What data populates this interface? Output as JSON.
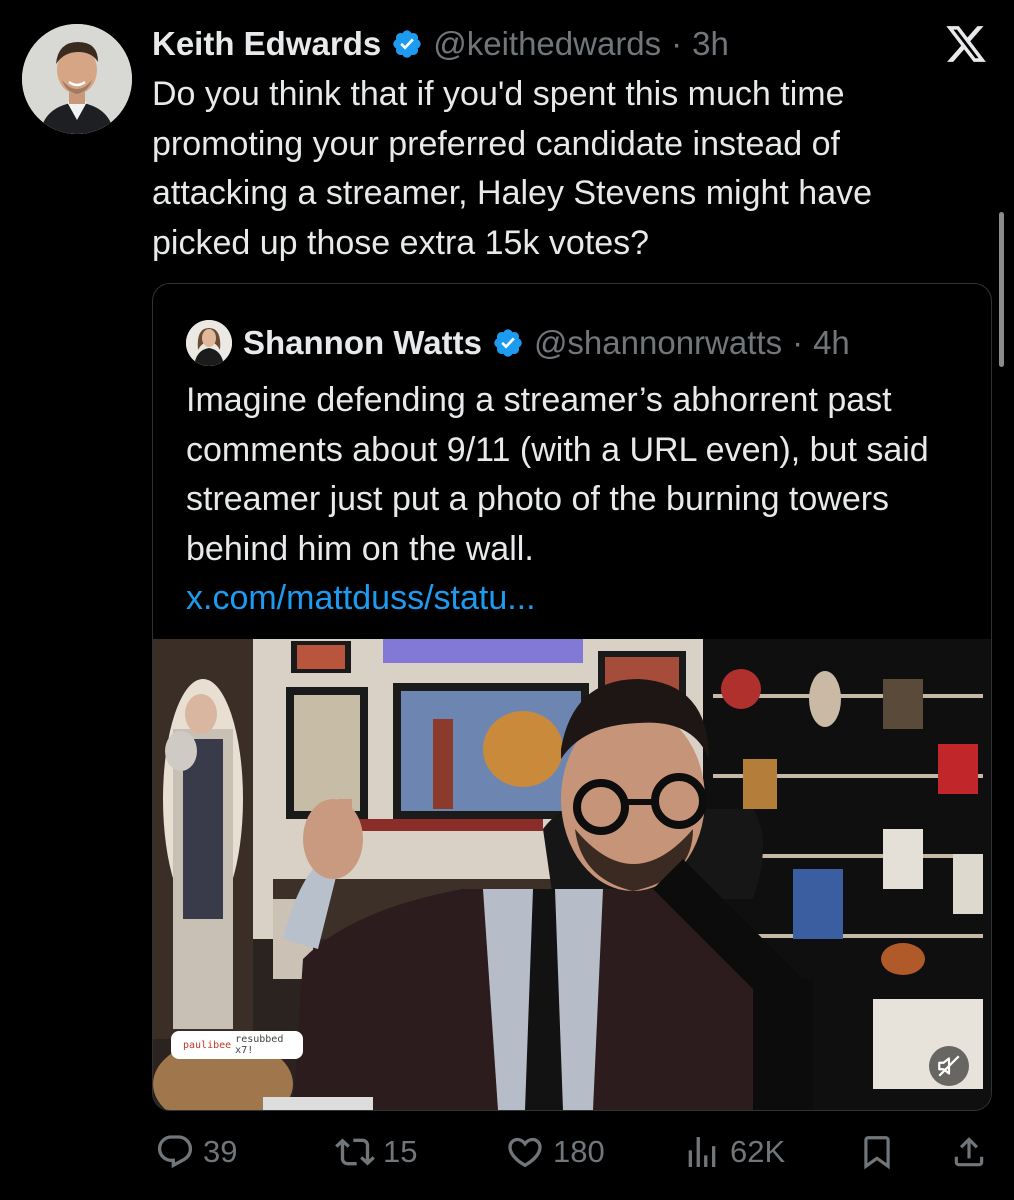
{
  "tweet": {
    "author": {
      "name": "Keith Edwards",
      "handle": "@keithedwards",
      "separator": "·",
      "time": "3h",
      "verified": true
    },
    "text": "Do you think that if you'd spent this much time promoting your preferred candidate instead of attacking a streamer, Haley Stevens might have picked up those extra 15k votes?"
  },
  "quoted_tweet": {
    "author": {
      "name": "Shannon Watts",
      "handle": "@shannonrwatts",
      "separator": "·",
      "time": "4h",
      "verified": true
    },
    "text": "Imagine defending a streamer’s abhorrent past comments about 9/11 (with a URL even), but said streamer just put a photo of the burning towers behind him on the wall.",
    "link": "x.com/mattduss/statu...",
    "media": {
      "chat_overlay_user": "paulibee",
      "chat_overlay_text": "resubbed x7!",
      "muted": true
    }
  },
  "actions": {
    "replies": "39",
    "reposts": "15",
    "likes": "180",
    "views": "62K"
  },
  "colors": {
    "background": "#000000",
    "text": "#e7e9ea",
    "secondary": "#71767b",
    "link": "#1d9bf0",
    "verified": "#1d9bf0",
    "border": "#2f3336"
  },
  "icons": {
    "verified": "verified-badge-icon",
    "x_logo": "x-logo-icon",
    "reply": "reply-icon",
    "repost": "repost-icon",
    "like": "heart-icon",
    "views": "views-icon",
    "bookmark": "bookmark-icon",
    "share": "share-icon",
    "mute": "muted-speaker-icon"
  }
}
